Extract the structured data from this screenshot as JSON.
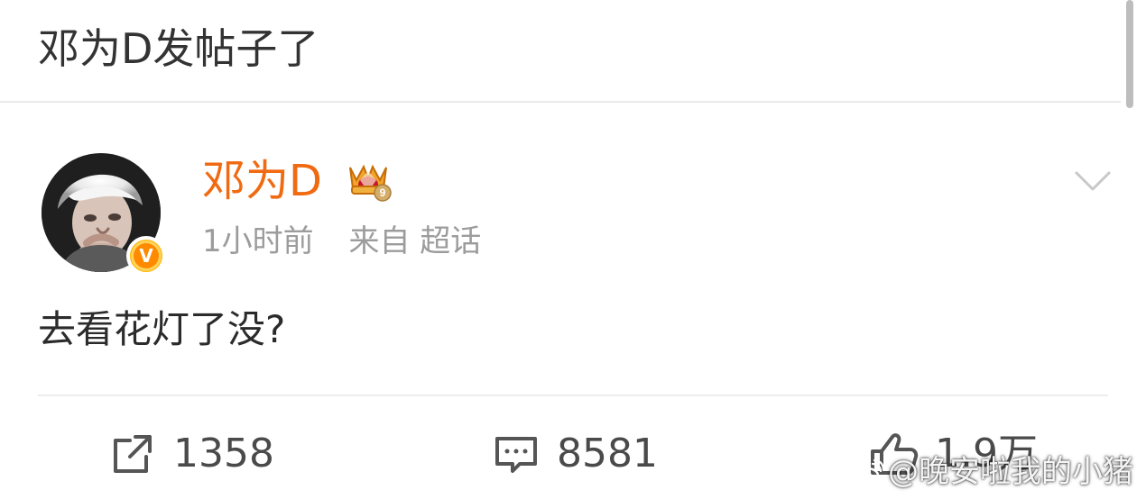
{
  "header": {
    "title": "邓为D发帖子了"
  },
  "post": {
    "author": "邓为D",
    "rank_level": "9",
    "time": "1小时前",
    "source": "来自 超话",
    "content": "去看花灯了没?",
    "verified_mark": "V"
  },
  "actions": {
    "repost_count": "1358",
    "comment_count": "8581",
    "like_count": "1.9万"
  },
  "watermark": {
    "text": "@晚安啦我的小猪"
  },
  "icons": {
    "repost": "repost-icon",
    "comment": "comment-icon",
    "like": "thumbs-up-icon",
    "menu": "chevron-down-icon",
    "verified": "verified-badge-icon",
    "rank": "crown-rank-icon",
    "weibo": "weibo-logo-icon"
  },
  "colors": {
    "username": "#f06a12",
    "muted": "#9c9c9c",
    "text": "#333333",
    "badge": "#ff8a00"
  }
}
